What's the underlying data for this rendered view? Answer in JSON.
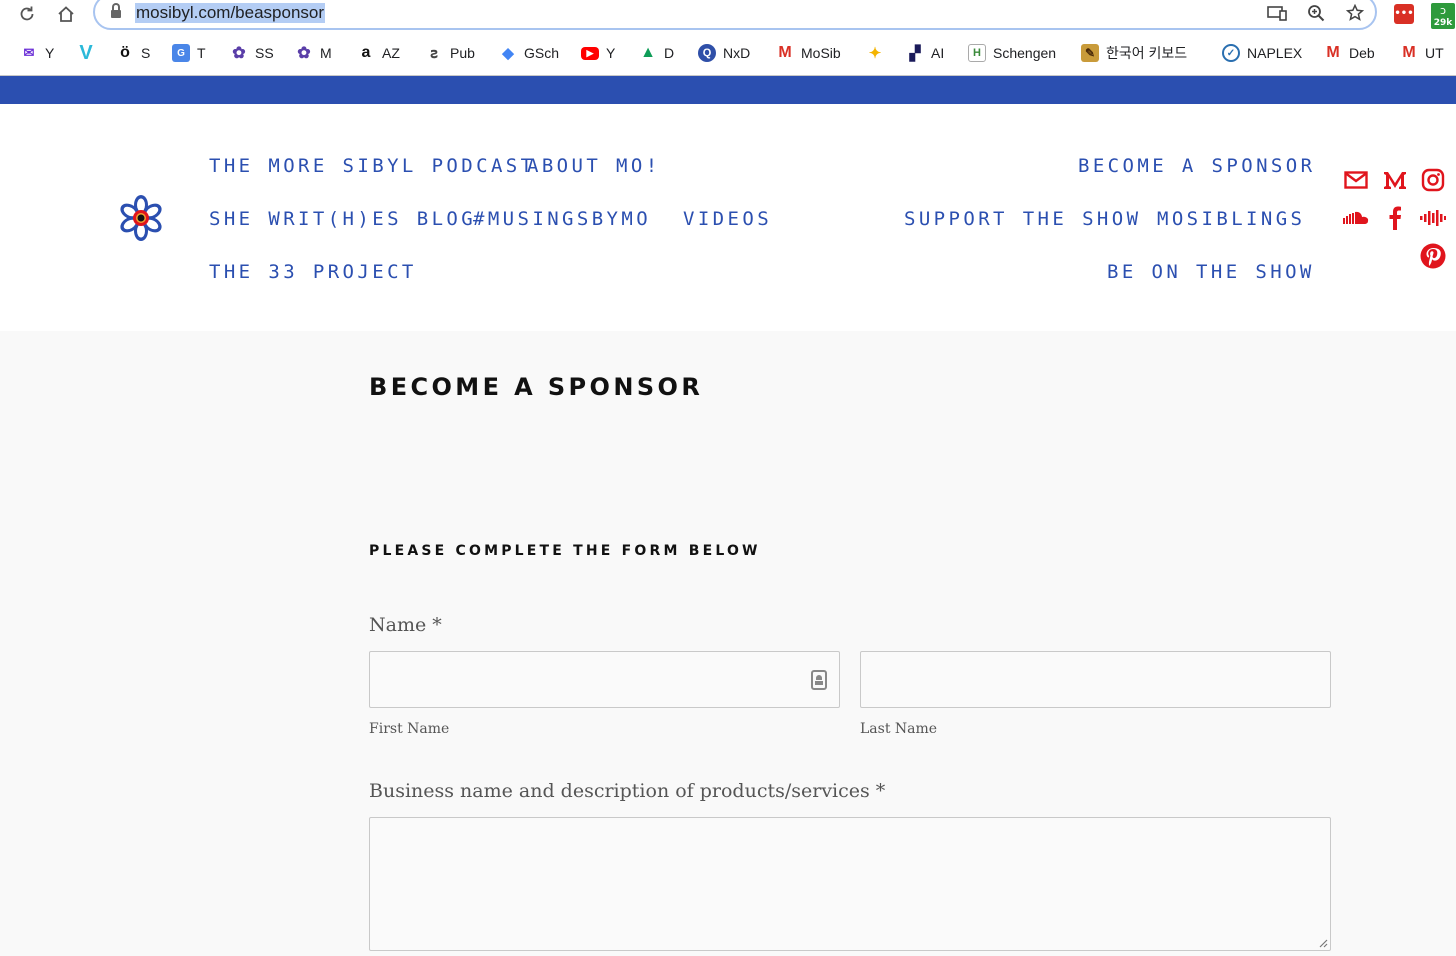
{
  "browser": {
    "url": "mosibyl.com/beasponsor",
    "reload_icon": "reload-icon",
    "home_icon": "home-icon",
    "extension_badge": "29k",
    "bookmarks": [
      {
        "label": "Y",
        "icon": "mail-icon",
        "color": "#6b2fd6"
      },
      {
        "label": "",
        "icon": "v-icon",
        "color": "#2bb9d9"
      },
      {
        "label": "S",
        "icon": "o-icon",
        "color": "#111111"
      },
      {
        "label": "T",
        "icon": "translate-icon",
        "color": "#4a86e8"
      },
      {
        "label": "SS",
        "icon": "flower-icon",
        "color": "#5a3ea8"
      },
      {
        "label": "M",
        "icon": "flower-icon",
        "color": "#5a3ea8"
      },
      {
        "label": "AZ",
        "icon": "amazon-icon",
        "color": "#111111"
      },
      {
        "label": "Pub",
        "icon": "pub-icon",
        "color": "#444444"
      },
      {
        "label": "GSch",
        "icon": "scholar-icon",
        "color": "#4285f4"
      },
      {
        "label": "Y",
        "icon": "youtube-icon",
        "color": "#ff0000"
      },
      {
        "label": "D",
        "icon": "drive-icon",
        "color": "#0f9d58"
      },
      {
        "label": "NxD",
        "icon": "q-icon",
        "color": "#2f4fa8"
      },
      {
        "label": "MoSib",
        "icon": "gmail-icon",
        "color": "#d93025"
      },
      {
        "label": "",
        "icon": "pinwheel-icon",
        "color": "#f4b400"
      },
      {
        "label": "AI",
        "icon": "grid-icon",
        "color": "#1a1a5a"
      },
      {
        "label": "Schengen",
        "icon": "hc-icon",
        "color": "#3a8a3a"
      },
      {
        "label": "한국어 키보드",
        "icon": "quill-icon",
        "color": "#7a4a1a"
      },
      {
        "label": "NAPLEX",
        "icon": "check-icon",
        "color": "#2a6fb0"
      },
      {
        "label": "Deb",
        "icon": "gmail-icon",
        "color": "#d93025"
      },
      {
        "label": "UT",
        "icon": "gmail-icon",
        "color": "#d93025"
      }
    ]
  },
  "site": {
    "brand_color": "#2b4fb0",
    "social_color": "#e0151d",
    "nav_left": {
      "podcast": "THE MORE SIBYL PODCAST",
      "about": "ABOUT MO!",
      "blog": "SHE WRIT(H)ES BLOG",
      "musings": "#MUSINGSBYMO",
      "videos": "VIDEOS",
      "project33": "THE 33 PROJECT"
    },
    "nav_right": {
      "sponsor": "BECOME A SPONSOR",
      "support": "SUPPORT THE SHOW",
      "mosiblings": "MOSIBLINGS",
      "be_on_show": "BE ON THE SHOW"
    },
    "social_icons": [
      "email-icon",
      "medium-icon",
      "instagram-icon",
      "soundcloud-icon",
      "facebook-icon",
      "podcast-icon",
      "pinterest-icon"
    ]
  },
  "page": {
    "title": "BECOME A SPONSOR",
    "subtitle": "PLEASE COMPLETE THE FORM BELOW",
    "form": {
      "name_label": "Name *",
      "first_name_label": "First Name",
      "last_name_label": "Last Name",
      "first_name_value": "",
      "last_name_value": "",
      "business_label": "Business name and description of products/services *",
      "business_value": ""
    }
  }
}
